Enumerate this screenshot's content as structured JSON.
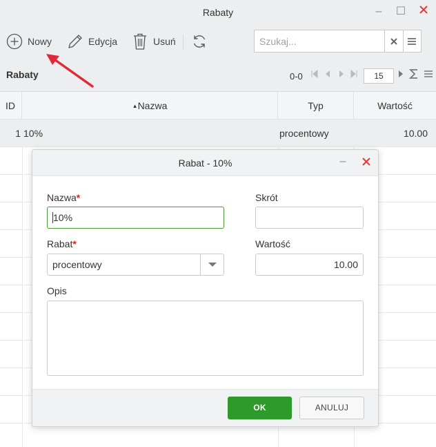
{
  "window": {
    "title": "Rabaty",
    "minimize_glyph": "–",
    "maximize_glyph": "☐"
  },
  "toolbar": {
    "new_label": "Nowy",
    "edit_label": "Edycja",
    "delete_label": "Usuń",
    "new_icon": "plus-circle-icon",
    "edit_icon": "pencil-icon",
    "delete_icon": "trash-icon",
    "refresh_icon": "refresh-icon"
  },
  "search": {
    "placeholder": "Szukaj...",
    "clear_icon": "clear-x-icon",
    "menu_icon": "hamburger-menu-icon"
  },
  "subbar": {
    "title": "Rabaty",
    "pager_count": "0-0",
    "page_size": "15"
  },
  "grid": {
    "columns": [
      "ID",
      "Nazwa",
      "Typ",
      "Wartość"
    ],
    "sorted_column": "Nazwa",
    "rows": [
      {
        "id": "1",
        "name": "10%",
        "type": "procentowy",
        "value": "10.00"
      }
    ]
  },
  "dialog": {
    "title": "Rabat - 10%",
    "fields": {
      "name_label": "Nazwa",
      "name_value": "10%",
      "short_label": "Skrót",
      "short_value": "",
      "discount_label": "Rabat",
      "discount_value": "procentowy",
      "value_label": "Wartość",
      "value_value": "10.00",
      "description_label": "Opis",
      "description_value": ""
    },
    "required_mark": "*",
    "ok_label": "OK",
    "cancel_label": "ANULUJ"
  },
  "colors": {
    "accent_green": "#2e9a2a",
    "required_red": "#e02020",
    "close_red": "#e53935",
    "annotation_arrow": "#e02a38"
  }
}
